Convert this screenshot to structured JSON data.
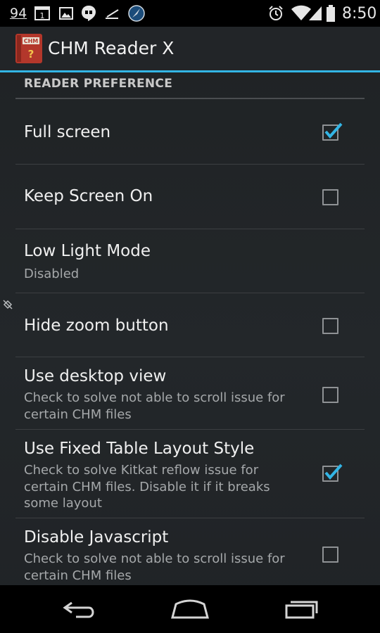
{
  "status_bar": {
    "battery_level": "94",
    "calendar_day": "1",
    "time": "8:50"
  },
  "action_bar": {
    "app_icon_text": "CHM",
    "app_icon_mark": "?",
    "title": "CHM Reader X"
  },
  "section": {
    "header": "READER PREFERENCE"
  },
  "preferences": [
    {
      "title": "Full screen",
      "summary": "",
      "checked": true
    },
    {
      "title": "Keep Screen On",
      "summary": "",
      "checked": false
    },
    {
      "title": "Low Light Mode",
      "summary": "Disabled"
    },
    {
      "title": "Hide zoom button",
      "summary": "",
      "checked": false
    },
    {
      "title": "Use desktop view",
      "summary": "Check to solve not able to scroll issue for certain CHM files",
      "checked": false
    },
    {
      "title": "Use Fixed Table Layout Style",
      "summary": "Check to solve Kitkat reflow issue for certain CHM files. Disable it if it breaks some layout",
      "checked": true
    },
    {
      "title": "Disable Javascript",
      "summary": "Check to solve not able to scroll issue for certain CHM files",
      "checked": false
    }
  ],
  "colors": {
    "accent": "#33b5e5",
    "background": "#222528",
    "text_primary": "#f0f0f0",
    "text_secondary": "#a5a8aa"
  },
  "icons": {
    "status": [
      "notification-count-icon",
      "calendar-icon",
      "image-icon",
      "hangouts-icon",
      "stopwatch-icon",
      "app-notification-icon",
      "alarm-icon",
      "wifi-icon",
      "signal-icon",
      "battery-icon"
    ],
    "navigation": [
      "back-icon",
      "home-icon",
      "recent-apps-icon"
    ]
  }
}
